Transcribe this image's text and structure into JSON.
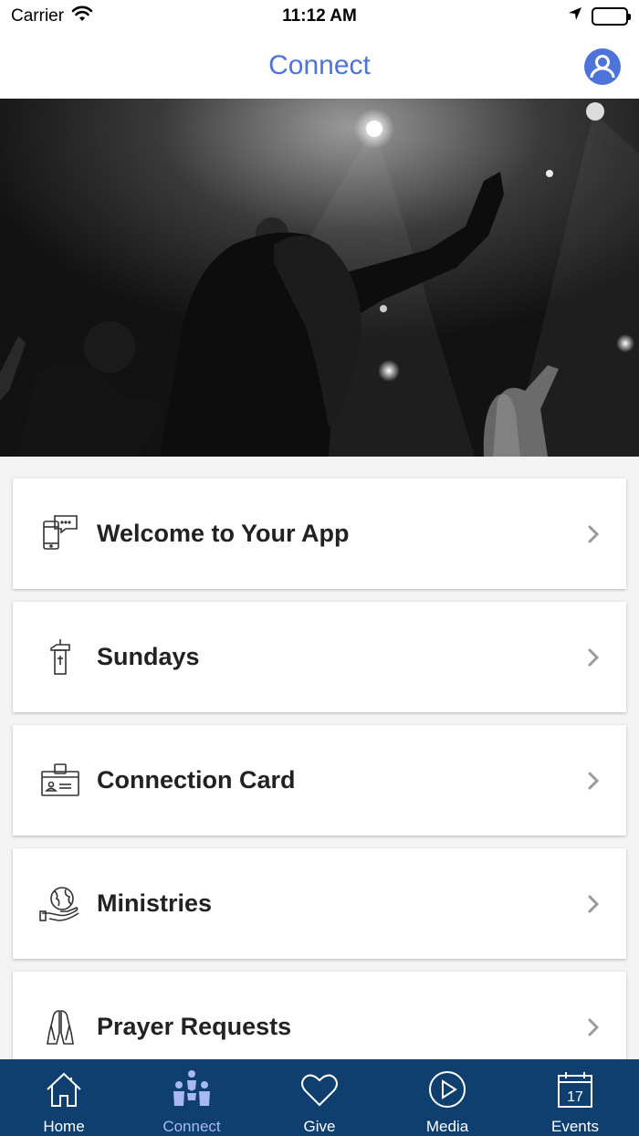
{
  "status_bar": {
    "carrier": "Carrier",
    "time": "11:12 AM"
  },
  "nav": {
    "title": "Connect",
    "profile_icon": "user-circle-icon"
  },
  "hero": {
    "icon": "worship-photo"
  },
  "menu": {
    "items": [
      {
        "label": "Welcome to Your App",
        "icon": "phone-chat-icon"
      },
      {
        "label": "Sundays",
        "icon": "pulpit-icon"
      },
      {
        "label": "Connection Card",
        "icon": "id-card-icon"
      },
      {
        "label": "Ministries",
        "icon": "globe-hand-icon"
      },
      {
        "label": "Prayer Requests",
        "icon": "praying-hands-icon"
      }
    ]
  },
  "tabs": [
    {
      "label": "Home",
      "icon": "home-icon",
      "active": false
    },
    {
      "label": "Connect",
      "icon": "people-icon",
      "active": true
    },
    {
      "label": "Give",
      "icon": "heart-icon",
      "active": false
    },
    {
      "label": "Media",
      "icon": "play-icon",
      "active": false
    },
    {
      "label": "Events",
      "icon": "calendar-icon",
      "active": false,
      "badge": "17"
    }
  ],
  "colors": {
    "accent": "#4e73d9",
    "tab_bar": "#0f3f6e",
    "tab_active": "#a9b8f5"
  }
}
